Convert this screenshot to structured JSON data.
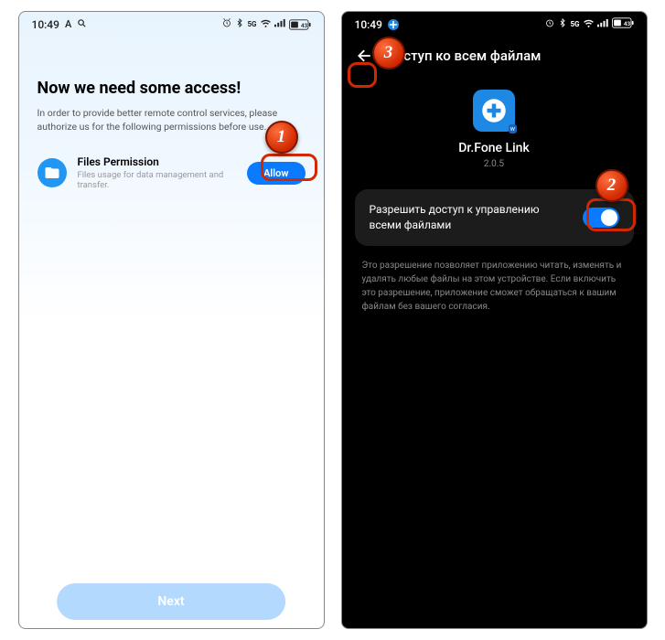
{
  "left": {
    "status": {
      "time": "10:49",
      "battery": "43"
    },
    "title": "Now we need some access!",
    "description": "In order to provide better remote control services, please authorize us for the following permissions before use.",
    "perm": {
      "title": "Files Permission",
      "sub": "Files usage for data management and transfer.",
      "allow": "Allow"
    },
    "next": "Next"
  },
  "right": {
    "status": {
      "time": "10:49",
      "battery": "43"
    },
    "header": "Доступ ко всем файлам",
    "app": {
      "name": "Dr.Fone Link",
      "version": "2.0.5"
    },
    "toggle_label": "Разрешить доступ к управлению всеми файлами",
    "perm_desc": "Это разрешение позволяет приложению читать, изменять и удалять любые файлы на этом устройстве. Если включить это разрешение, приложение сможет обращаться к вашим файлам без вашего согласия."
  },
  "callouts": {
    "one": "1",
    "two": "2",
    "three": "3"
  }
}
